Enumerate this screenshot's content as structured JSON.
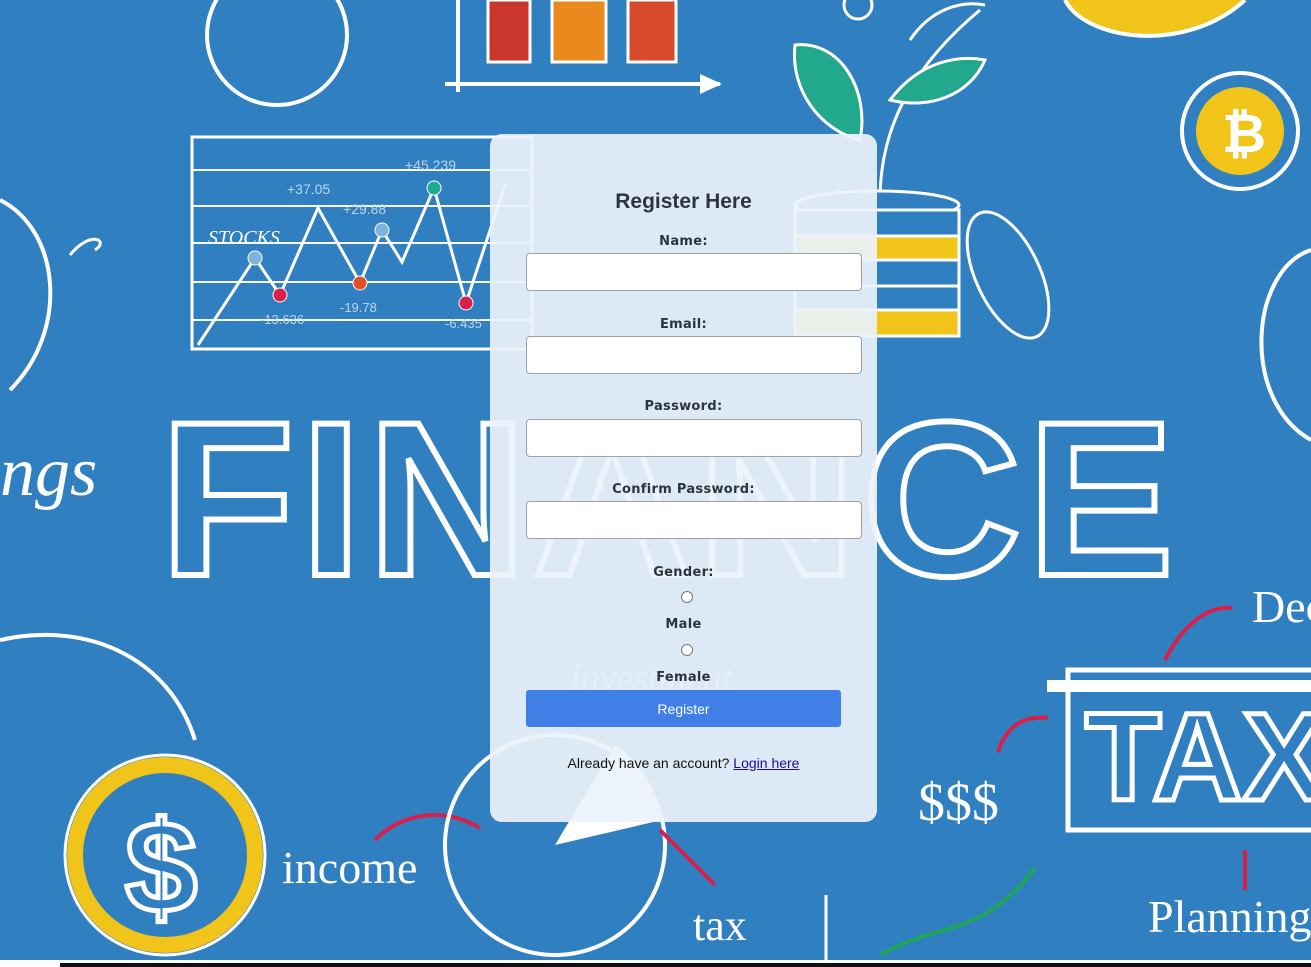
{
  "background": {
    "word": "FINANCE",
    "stocks_label": "STOCKS",
    "stock_values": [
      "+37.05",
      "+29.88",
      "+45.239",
      "-19.78",
      "-13.636",
      "-6.435"
    ],
    "income_label": "income",
    "tax_label": "tax",
    "tax_sign": "TAX",
    "dollars_label": "$$$",
    "planning_label": "Planning",
    "investment_label": "investment",
    "savings_fragment": "ngs",
    "dec_fragment": "Dec",
    "colors": {
      "bg": "#2f7fc1",
      "gold": "#f0c419",
      "red": "#d8204a",
      "teal": "#22a88c"
    }
  },
  "form": {
    "title": "Register Here",
    "fields": [
      {
        "label": "Name:",
        "value": ""
      },
      {
        "label": "Email:",
        "value": ""
      },
      {
        "label": "Password:",
        "value": ""
      },
      {
        "label": "Confirm Password:",
        "value": ""
      }
    ],
    "gender": {
      "label": "Gender:",
      "options": [
        "Male",
        "Female"
      ]
    },
    "submit_label": "Register",
    "footer_text": "Already have an account?",
    "login_link": "Login here",
    "colors": {
      "button": "#4080e6",
      "link": "#1a0dab"
    }
  }
}
